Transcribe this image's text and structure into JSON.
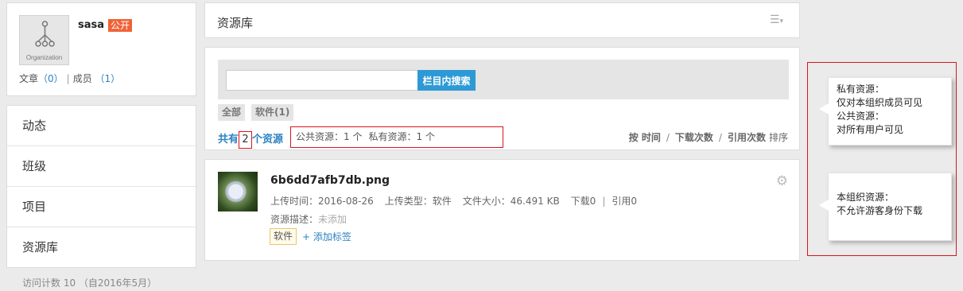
{
  "profile": {
    "avatar_text": "Organization",
    "name": "sasa",
    "badge": "公开",
    "articles_label": "文章",
    "articles_count": "（0）",
    "separator": "|",
    "members_label": "成员",
    "members_count": "（1）"
  },
  "nav": {
    "items": [
      {
        "label": "动态"
      },
      {
        "label": "班级"
      },
      {
        "label": "项目"
      },
      {
        "label": "资源库"
      }
    ]
  },
  "visit_count": "访问计数 10 （自2016年5月）",
  "header": {
    "title": "资源库",
    "menu_icon": "list-menu-icon"
  },
  "search": {
    "placeholder": "",
    "button_label": "栏目内搜索"
  },
  "filters": [
    {
      "label": "全部"
    },
    {
      "label": "软件(1)"
    }
  ],
  "count": {
    "prefix": "共有",
    "number": "2",
    "suffix": "个资源",
    "public_text": "公共资源：1 个",
    "private_text": "私有资源：1 个"
  },
  "sort": {
    "by_time": "按 时间",
    "by_downloads": "下载次数",
    "by_citations": "引用次数",
    "sort_label": "排序"
  },
  "resource": {
    "file_name": "6b6dd7afb7db.png",
    "upload_time": "上传时间：2016-08-26",
    "upload_type": "上传类型：软件",
    "file_size": "文件大小：46.491 KB",
    "downloads": "下载0",
    "separator": "|",
    "citations": "引用0",
    "desc_label": "资源描述：",
    "desc_value": "未添加",
    "tag": "软件",
    "add_tag": "+ 添加标签"
  },
  "callouts": {
    "line1": "私有资源：",
    "line2": "仅对本组织成员可见",
    "line3": "公共资源：",
    "line4": "对所有用户可见",
    "line5": "本组织资源：",
    "line6": "不允许游客身份下载"
  },
  "colors": {
    "accent_blue": "#2d9ad6",
    "badge_orange": "#f06237",
    "annotation_red": "#d9141b"
  }
}
